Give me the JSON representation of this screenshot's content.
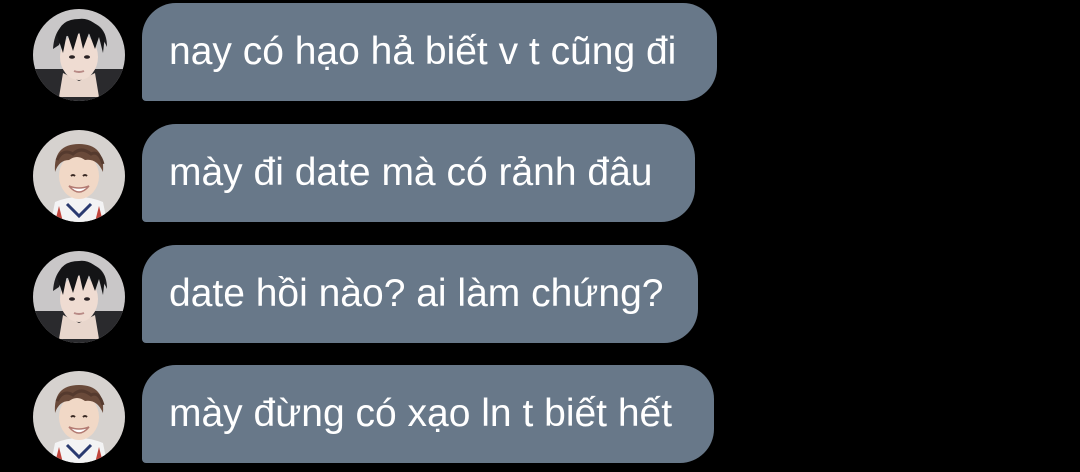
{
  "messages": [
    {
      "sender": "avatar-dark-hair",
      "text": "nay có hạo hả biết v t cũng đi"
    },
    {
      "sender": "avatar-smiling",
      "text": "mày đi date mà có rảnh đâu"
    },
    {
      "sender": "avatar-dark-hair",
      "text": "date hồi nào? ai làm chứng?"
    },
    {
      "sender": "avatar-smiling",
      "text": "mày đừng có xạo ln t biết hết"
    }
  ],
  "colors": {
    "background": "#000000",
    "bubble": "#687889",
    "text": "#ffffff"
  }
}
